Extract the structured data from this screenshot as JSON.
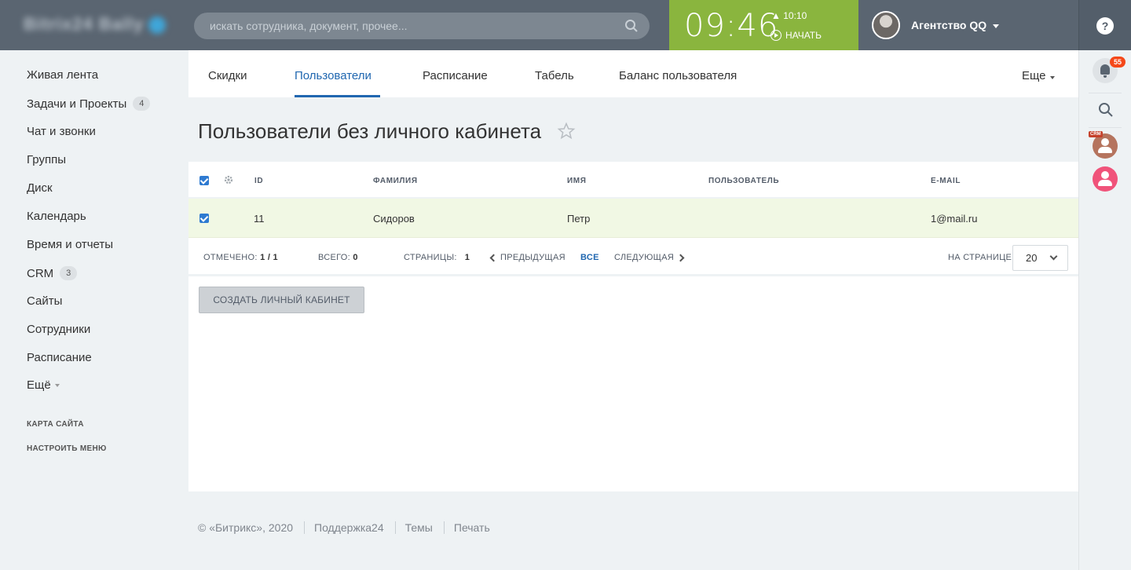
{
  "header": {
    "logo_text": "Bitrix24 Bally",
    "search_placeholder": "искать сотрудника, документ, прочее...",
    "clock_time": "09:46",
    "alarm_time": "10:10",
    "start_label": "НАЧАТЬ",
    "user_name": "Агентство QQ",
    "help_label": "?"
  },
  "left_menu": {
    "items": [
      {
        "label": "Живая лента"
      },
      {
        "label": "Задачи и Проекты",
        "count": "4"
      },
      {
        "label": "Чат и звонки"
      },
      {
        "label": "Группы"
      },
      {
        "label": "Диск"
      },
      {
        "label": "Календарь"
      },
      {
        "label": "Время и отчеты"
      },
      {
        "label": "CRM",
        "count": "3"
      },
      {
        "label": "Сайты"
      },
      {
        "label": "Сотрудники"
      },
      {
        "label": "Расписание"
      },
      {
        "label": "Ещё"
      }
    ],
    "sitemap_label": "КАРТА САЙТА",
    "configure_label": "НАСТРОИТЬ МЕНЮ"
  },
  "right_rail": {
    "notification_count": "55",
    "crm_tag": "CRM",
    "colors": {
      "crm_avatar": "#b5745e",
      "user_avatar": "#f0537a"
    }
  },
  "tabs": {
    "items": [
      {
        "label": "Скидки"
      },
      {
        "label": "Пользователи",
        "active": true
      },
      {
        "label": "Расписание"
      },
      {
        "label": "Табель"
      },
      {
        "label": "Баланс пользователя"
      }
    ],
    "more_label": "Еще"
  },
  "page": {
    "title": "Пользователи без личного кабинета"
  },
  "grid": {
    "columns": [
      "ID",
      "ФАМИЛИЯ",
      "ИМЯ",
      "ПОЛЬЗОВАТЕЛЬ",
      "E-MAIL"
    ],
    "rows": [
      {
        "id": "11",
        "last_name": "Сидоров",
        "first_name": "Петр",
        "user": "",
        "email": "1@mail.ru",
        "checked": true
      }
    ],
    "nav": {
      "selected_label": "ОТМЕЧЕНО:",
      "selected_value": "1 / 1",
      "total_label": "ВСЕГО:",
      "total_value": "0",
      "pages_label": "СТРАНИЦЫ:",
      "pages_value": "1",
      "prev_label": "ПРЕДЫДУЩАЯ",
      "all_label": "ВСЕ",
      "next_label": "СЛЕДУЮЩАЯ",
      "per_page_label": "НА СТРАНИЦЕ:",
      "per_page_value": "20"
    },
    "create_button_label": "СОЗДАТЬ ЛИЧНЫЙ КАБИНЕТ"
  },
  "footer": {
    "copyright": "© «Битрикс», 2020",
    "links": [
      "Поддержка24",
      "Темы",
      "Печать"
    ]
  },
  "colors": {
    "header_bg": "#5a6571",
    "clock_bg": "#8ab53e",
    "accent": "#2067b0",
    "checkbox": "#2e7ad1",
    "selected_row_bg": "#f1f8e4"
  }
}
